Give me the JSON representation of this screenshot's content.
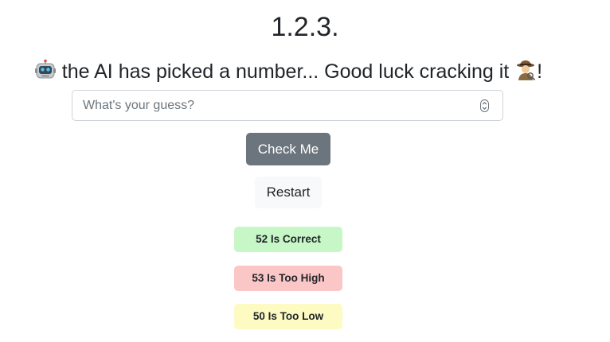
{
  "header": {
    "title": "1.2.3.",
    "subtitle_prefix_icon": "robot-emoji-icon",
    "subtitle_text": " the AI has picked a number... Good luck cracking it ",
    "subtitle_suffix_icon": "detective-emoji-icon",
    "subtitle_end": "!"
  },
  "form": {
    "guess_placeholder": "What's your guess?",
    "guess_value": "",
    "check_label": "Check Me",
    "restart_label": "Restart"
  },
  "results": [
    {
      "text": "52 Is Correct",
      "status": "correct",
      "color": "#c7f7c7"
    },
    {
      "text": "53 Is Too High",
      "status": "too-high",
      "color": "#fbc6c6"
    },
    {
      "text": "50 Is Too Low",
      "status": "too-low",
      "color": "#fdfbc2"
    }
  ],
  "colors": {
    "primary_button": "#6c757d",
    "secondary_button": "#f8f9fa"
  }
}
